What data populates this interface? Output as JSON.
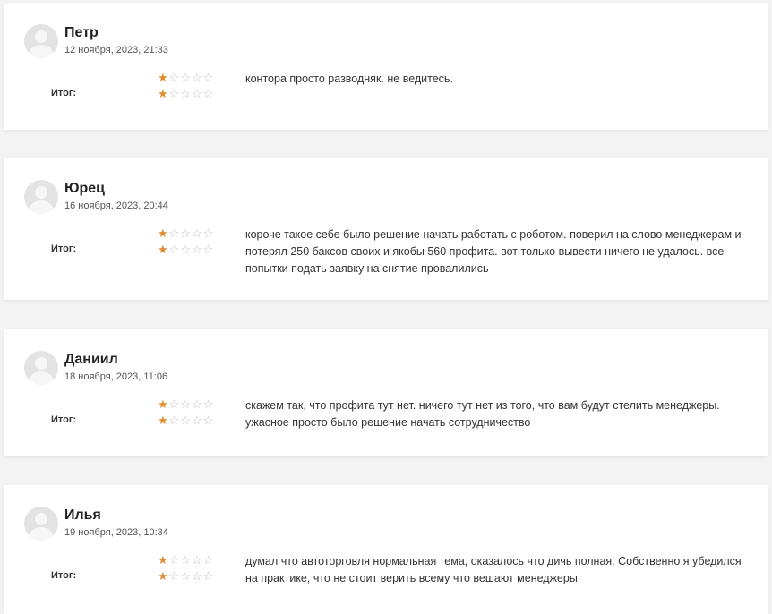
{
  "rating_label": "Итог:",
  "colors": {
    "star_filled": "#e08b2c",
    "star_empty": "#bdbdbd"
  },
  "reviews": [
    {
      "author": "Петр",
      "date": "12 ноября, 2023, 21:33",
      "rating": 1,
      "rating_max": 5,
      "total_rating": 1,
      "text": "контора просто разводняк. не ведитесь."
    },
    {
      "author": "Юрец",
      "date": "16 ноября, 2023, 20:44",
      "rating": 1,
      "rating_max": 5,
      "total_rating": 1,
      "text": "короче такое себе было решение начать работать с роботом. поверил на слово менеджерам и потерял 250 баксов своих и якобы 560 профита. вот только вывести ничего не удалось. все попытки подать заявку на снятие провалились"
    },
    {
      "author": "Даниил",
      "date": "18 ноября, 2023, 11:06",
      "rating": 1,
      "rating_max": 5,
      "total_rating": 1,
      "text": "скажем так, что профита тут нет. ничего тут нет из того, что вам будут стелить менеджеры. ужасное просто было решение начать сотрудничество"
    },
    {
      "author": "Илья",
      "date": "19 ноября, 2023, 10:34",
      "rating": 1,
      "rating_max": 5,
      "total_rating": 1,
      "text": "думал что автоторговля нормальная тема, оказалось что дичь полная. Собственно я убедился на практике, что не стоит верить всему что вешают менеджеры"
    }
  ]
}
